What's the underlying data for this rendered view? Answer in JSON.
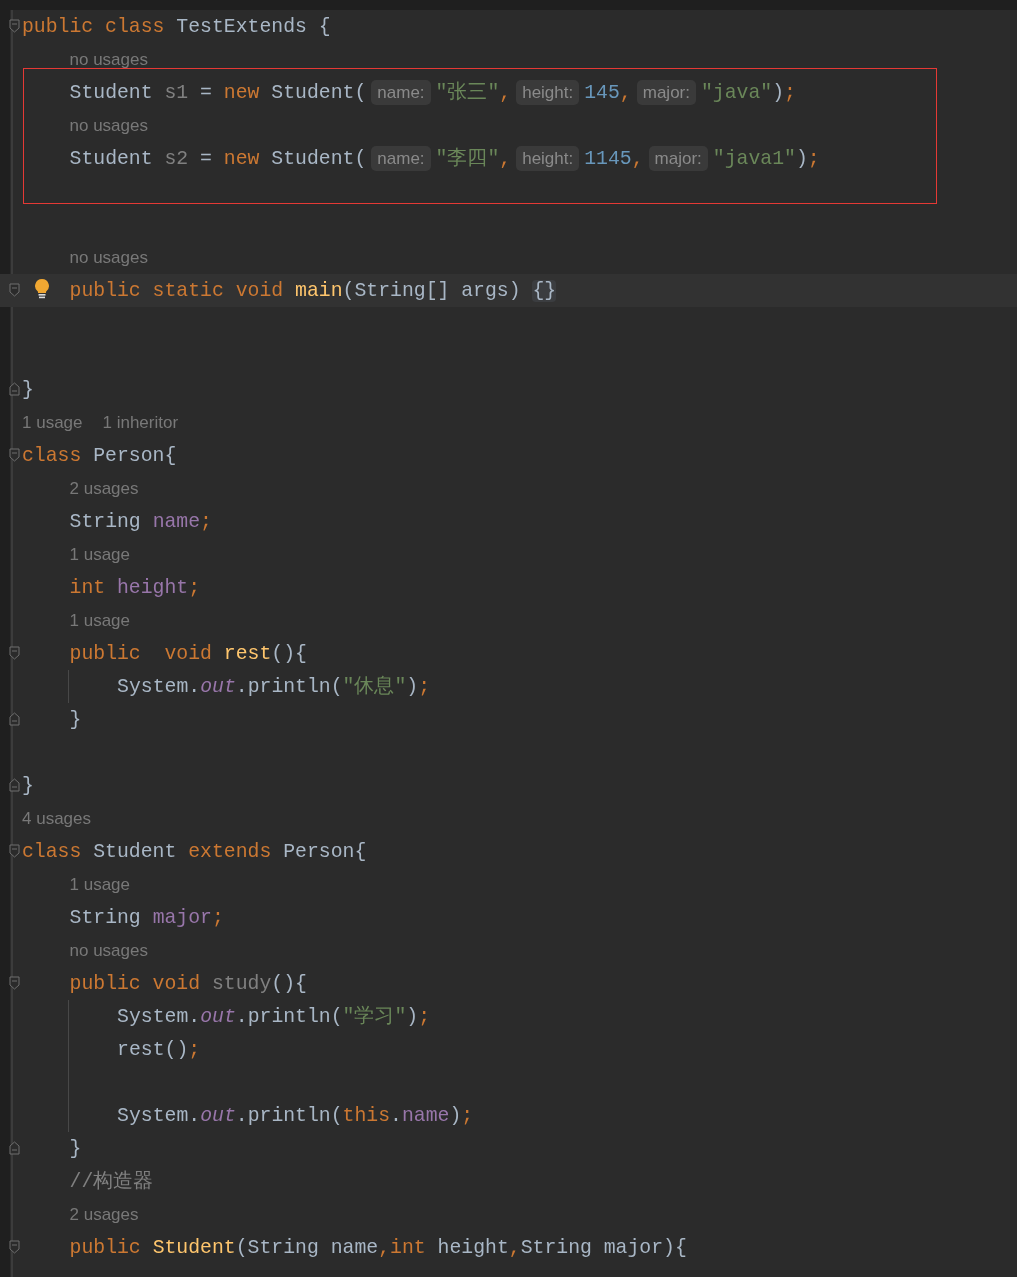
{
  "editor": {
    "annotation": {
      "kind": "rectangle",
      "color": "#e53935"
    },
    "rows": [
      {
        "kind": "code",
        "fold_start": true,
        "tokens": [
          {
            "kind": "keyword",
            "text": "public class "
          },
          {
            "kind": "plain",
            "text": "TestExtends {"
          }
        ]
      },
      {
        "kind": "hint",
        "hints": [
          "no usages"
        ]
      },
      {
        "kind": "code",
        "tokens": [
          {
            "kind": "plain",
            "text": "    Student "
          },
          {
            "kind": "unused",
            "text": "s1"
          },
          {
            "kind": "plain",
            "text": " = "
          },
          {
            "kind": "keyword",
            "text": "new "
          },
          {
            "kind": "plain",
            "text": "Student("
          },
          {
            "kind": "param",
            "text": "name:"
          },
          {
            "kind": "string",
            "text": "\"张三\""
          },
          {
            "kind": "punct",
            "text": ","
          },
          {
            "kind": "param",
            "text": "height:"
          },
          {
            "kind": "number",
            "text": "145"
          },
          {
            "kind": "punct",
            "text": ","
          },
          {
            "kind": "param",
            "text": "major:"
          },
          {
            "kind": "string",
            "text": "\"java\""
          },
          {
            "kind": "plain",
            "text": ")"
          },
          {
            "kind": "punct",
            "text": ";"
          }
        ]
      },
      {
        "kind": "hint",
        "hints": [
          "no usages"
        ]
      },
      {
        "kind": "code",
        "tokens": [
          {
            "kind": "plain",
            "text": "    Student "
          },
          {
            "kind": "unused",
            "text": "s2"
          },
          {
            "kind": "plain",
            "text": " = "
          },
          {
            "kind": "keyword",
            "text": "new "
          },
          {
            "kind": "plain",
            "text": "Student("
          },
          {
            "kind": "param",
            "text": "name:"
          },
          {
            "kind": "string",
            "text": "\"李四\""
          },
          {
            "kind": "punct",
            "text": ","
          },
          {
            "kind": "param",
            "text": "height:"
          },
          {
            "kind": "number",
            "text": "1145"
          },
          {
            "kind": "punct",
            "text": ","
          },
          {
            "kind": "param",
            "text": "major:"
          },
          {
            "kind": "string",
            "text": "\"java1\""
          },
          {
            "kind": "plain",
            "text": ")"
          },
          {
            "kind": "punct",
            "text": ";"
          }
        ]
      },
      {
        "kind": "blank"
      },
      {
        "kind": "blank"
      },
      {
        "kind": "hint",
        "hints": [
          "no usages"
        ]
      },
      {
        "kind": "code",
        "fold_start": true,
        "current": true,
        "bulb": true,
        "tokens": [
          {
            "kind": "keyword",
            "text": "    public static void "
          },
          {
            "kind": "declaration",
            "text": "main"
          },
          {
            "kind": "plain",
            "text": "(String[] args) "
          },
          {
            "kind": "folded",
            "text": "{}"
          }
        ]
      },
      {
        "kind": "blank"
      },
      {
        "kind": "blank"
      },
      {
        "kind": "code",
        "fold_end": true,
        "tokens": [
          {
            "kind": "plain",
            "text": "}"
          }
        ]
      },
      {
        "kind": "hint",
        "hints": [
          "1 usage",
          "1 inheritor"
        ]
      },
      {
        "kind": "code",
        "fold_start": true,
        "tokens": [
          {
            "kind": "keyword",
            "text": "class "
          },
          {
            "kind": "plain",
            "text": "Person{"
          }
        ]
      },
      {
        "kind": "hint",
        "hints": [
          "2 usages"
        ]
      },
      {
        "kind": "code",
        "tokens": [
          {
            "kind": "plain",
            "text": "    String "
          },
          {
            "kind": "field",
            "text": "name"
          },
          {
            "kind": "punct",
            "text": ";"
          }
        ]
      },
      {
        "kind": "hint",
        "hints": [
          "1 usage"
        ]
      },
      {
        "kind": "code",
        "tokens": [
          {
            "kind": "keyword",
            "text": "    int "
          },
          {
            "kind": "field",
            "text": "height"
          },
          {
            "kind": "punct",
            "text": ";"
          }
        ]
      },
      {
        "kind": "hint",
        "hints": [
          "1 usage"
        ]
      },
      {
        "kind": "code",
        "fold_start": true,
        "tokens": [
          {
            "kind": "keyword",
            "text": "    public  void "
          },
          {
            "kind": "declaration",
            "text": "rest"
          },
          {
            "kind": "plain",
            "text": "(){"
          }
        ]
      },
      {
        "kind": "code",
        "guide": true,
        "tokens": [
          {
            "kind": "plain",
            "text": "        System."
          },
          {
            "kind": "static",
            "text": "out"
          },
          {
            "kind": "plain",
            "text": ".println("
          },
          {
            "kind": "string",
            "text": "\"休息\""
          },
          {
            "kind": "plain",
            "text": ")"
          },
          {
            "kind": "punct",
            "text": ";"
          }
        ]
      },
      {
        "kind": "code",
        "fold_end": true,
        "tokens": [
          {
            "kind": "plain",
            "text": "    }"
          }
        ]
      },
      {
        "kind": "blank"
      },
      {
        "kind": "code",
        "fold_end": true,
        "tokens": [
          {
            "kind": "plain",
            "text": "}"
          }
        ]
      },
      {
        "kind": "hint",
        "hints": [
          "4 usages"
        ]
      },
      {
        "kind": "code",
        "fold_start": true,
        "tokens": [
          {
            "kind": "keyword",
            "text": "class "
          },
          {
            "kind": "plain",
            "text": "Student "
          },
          {
            "kind": "keyword",
            "text": "extends "
          },
          {
            "kind": "plain",
            "text": "Person{"
          }
        ]
      },
      {
        "kind": "hint",
        "hints": [
          "1 usage"
        ]
      },
      {
        "kind": "code",
        "tokens": [
          {
            "kind": "plain",
            "text": "    String "
          },
          {
            "kind": "field",
            "text": "major"
          },
          {
            "kind": "punct",
            "text": ";"
          }
        ]
      },
      {
        "kind": "hint",
        "hints": [
          "no usages"
        ]
      },
      {
        "kind": "code",
        "fold_start": true,
        "tokens": [
          {
            "kind": "keyword",
            "text": "    public void "
          },
          {
            "kind": "unused",
            "text": "study"
          },
          {
            "kind": "plain",
            "text": "(){"
          }
        ]
      },
      {
        "kind": "code",
        "guide": true,
        "tokens": [
          {
            "kind": "plain",
            "text": "        System."
          },
          {
            "kind": "static",
            "text": "out"
          },
          {
            "kind": "plain",
            "text": ".println("
          },
          {
            "kind": "string",
            "text": "\"学习\""
          },
          {
            "kind": "plain",
            "text": ")"
          },
          {
            "kind": "punct",
            "text": ";"
          }
        ]
      },
      {
        "kind": "code",
        "guide": true,
        "tokens": [
          {
            "kind": "plain",
            "text": "        rest()"
          },
          {
            "kind": "punct",
            "text": ";"
          }
        ]
      },
      {
        "kind": "blank",
        "guide": true
      },
      {
        "kind": "code",
        "guide": true,
        "tokens": [
          {
            "kind": "plain",
            "text": "        System."
          },
          {
            "kind": "static",
            "text": "out"
          },
          {
            "kind": "plain",
            "text": ".println("
          },
          {
            "kind": "keyword",
            "text": "this"
          },
          {
            "kind": "plain",
            "text": "."
          },
          {
            "kind": "field",
            "text": "name"
          },
          {
            "kind": "plain",
            "text": ")"
          },
          {
            "kind": "punct",
            "text": ";"
          }
        ]
      },
      {
        "kind": "code",
        "fold_end": true,
        "tokens": [
          {
            "kind": "plain",
            "text": "    }"
          }
        ]
      },
      {
        "kind": "code",
        "tokens": [
          {
            "kind": "comment",
            "text": "    //构造器"
          }
        ]
      },
      {
        "kind": "hint",
        "hints": [
          "2 usages"
        ]
      },
      {
        "kind": "code",
        "fold_start": true,
        "tokens": [
          {
            "kind": "keyword",
            "text": "    public "
          },
          {
            "kind": "declaration",
            "text": "Student"
          },
          {
            "kind": "plain",
            "text": "(String name"
          },
          {
            "kind": "keyword",
            "text": ",int "
          },
          {
            "kind": "plain",
            "text": "height"
          },
          {
            "kind": "punct_lead",
            "text": ",String major){"
          }
        ]
      }
    ]
  }
}
